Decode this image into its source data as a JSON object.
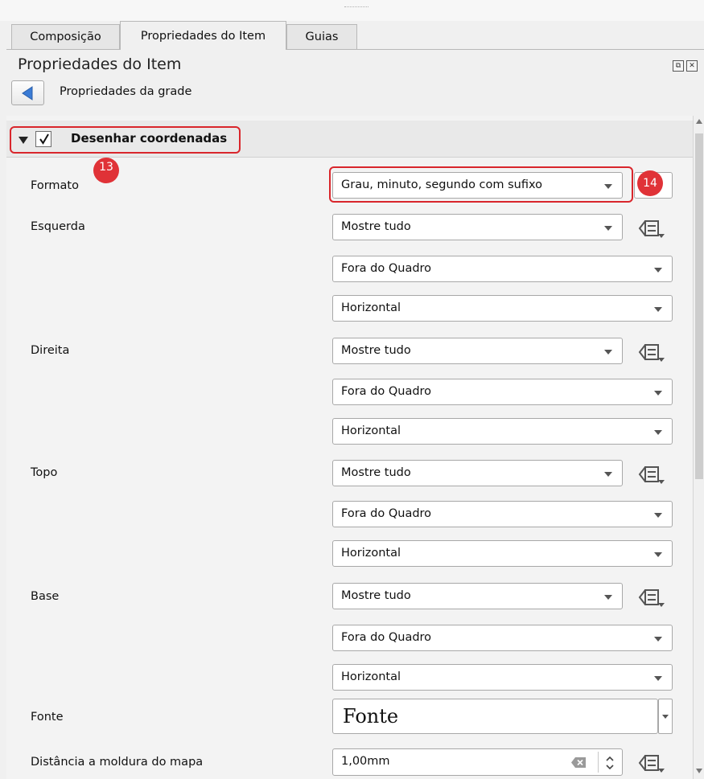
{
  "tabs": [
    {
      "label": "Composição",
      "active": false
    },
    {
      "label": "Propriedades do Item",
      "active": true
    },
    {
      "label": "Guias",
      "active": false
    }
  ],
  "panel": {
    "title": "Propriedades do Item",
    "subtitle": "Propriedades da grade"
  },
  "group": {
    "label": "Desenhar coordenadas",
    "checked": true,
    "expanded": true
  },
  "annotations": {
    "badge13": "13",
    "badge14": "14",
    "highlight_color": "#d9262c"
  },
  "form": {
    "formato": {
      "label": "Formato",
      "value": "Grau, minuto, segundo com sufixo"
    },
    "esquerda": {
      "label": "Esquerda",
      "display": "Mostre tudo",
      "position": "Fora do Quadro",
      "direction": "Horizontal"
    },
    "direita": {
      "label": "Direita",
      "display": "Mostre tudo",
      "position": "Fora do Quadro",
      "direction": "Horizontal"
    },
    "topo": {
      "label": "Topo",
      "display": "Mostre tudo",
      "position": "Fora do Quadro",
      "direction": "Horizontal"
    },
    "base": {
      "label": "Base",
      "display": "Mostre tudo",
      "position": "Fora do Quadro",
      "direction": "Horizontal"
    },
    "fonte": {
      "label": "Fonte",
      "button": "Fonte"
    },
    "distancia": {
      "label": "Distância a moldura do mapa",
      "value": "1,00mm"
    }
  },
  "icons": {
    "back": "back-arrow-icon",
    "data_defined": "data-defined-override-icon",
    "clear": "clear-icon",
    "stepper": "spin-stepper-icon"
  }
}
